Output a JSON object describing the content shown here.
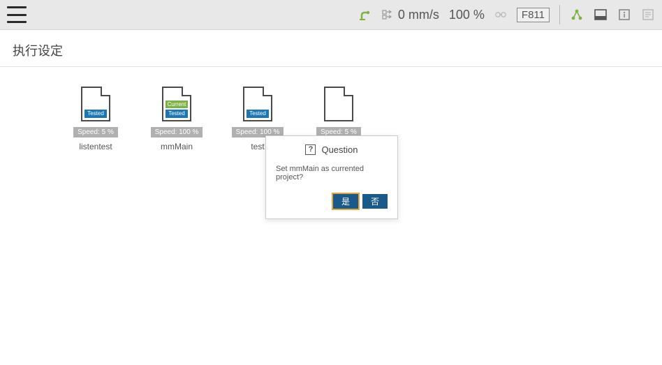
{
  "topbar": {
    "speed_value": "0 mm/s",
    "override_value": "100 %",
    "code": "F811"
  },
  "page": {
    "title": "执行设定"
  },
  "projects": [
    {
      "name": "listentest",
      "speed": "Speed: 5 %",
      "tags": [
        "Tested"
      ]
    },
    {
      "name": "mmMain",
      "speed": "Speed: 100 %",
      "tags": [
        "Current",
        "Tested"
      ]
    },
    {
      "name": "test",
      "speed": "Speed: 100 %",
      "tags": [
        "Tested"
      ]
    },
    {
      "name": "",
      "speed": "Speed: 5 %",
      "tags": []
    }
  ],
  "dialog": {
    "title": "Question",
    "message": "Set mmMain as currented project?",
    "yes_label": "是",
    "no_label": "否"
  }
}
